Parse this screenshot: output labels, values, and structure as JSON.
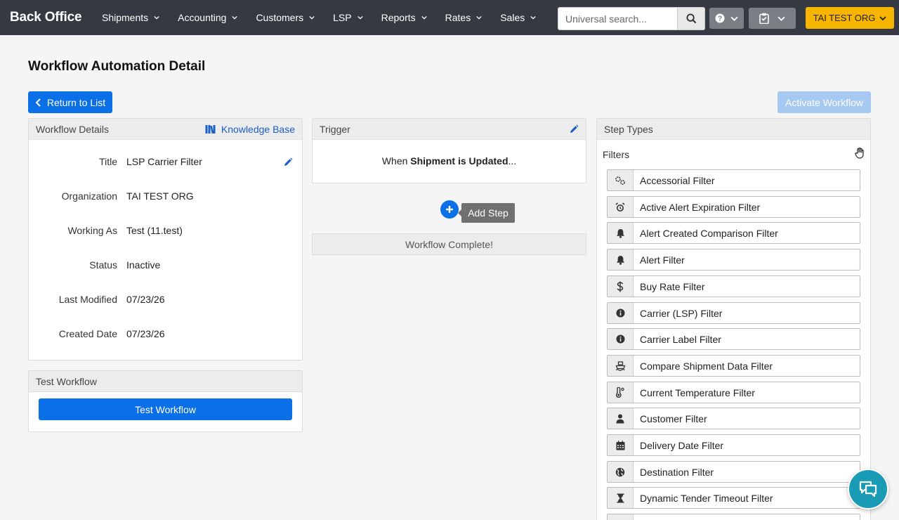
{
  "nav": {
    "brand": "Back Office",
    "items": [
      "Shipments",
      "Accounting",
      "Customers",
      "LSP",
      "Reports",
      "Rates",
      "Sales"
    ],
    "search_placeholder": "Universal search...",
    "org_label": "TAI TEST ORG"
  },
  "page": {
    "title": "Workflow Automation Detail",
    "return_label": "Return to List",
    "activate_label": "Activate Workflow"
  },
  "details": {
    "header": "Workflow Details",
    "kb_label": "Knowledge Base",
    "rows": [
      {
        "label": "Title",
        "value": "LSP Carrier Filter"
      },
      {
        "label": "Organization",
        "value": "TAI TEST ORG"
      },
      {
        "label": "Working As",
        "value": "Test (11.test)"
      },
      {
        "label": "Status",
        "value": "Inactive"
      },
      {
        "label": "Last Modified",
        "value": "07/23/26"
      },
      {
        "label": "Created Date",
        "value": "07/23/26"
      }
    ]
  },
  "test": {
    "header": "Test Workflow",
    "button_label": "Test Workflow"
  },
  "trigger": {
    "header": "Trigger",
    "prefix": "When ",
    "event": "Shipment is Updated",
    "suffix": "...",
    "add_step_label": "Add Step",
    "complete_label": "Workflow Complete!"
  },
  "steps": {
    "header": "Step Types",
    "section": "Filters",
    "items": [
      {
        "label": "Accessorial Filter",
        "icon": "gears-icon"
      },
      {
        "label": "Active Alert Expiration Filter",
        "icon": "alarm-clock-icon"
      },
      {
        "label": "Alert Created Comparison Filter",
        "icon": "bell-icon"
      },
      {
        "label": "Alert Filter",
        "icon": "bell-icon"
      },
      {
        "label": "Buy Rate Filter",
        "icon": "dollar-icon"
      },
      {
        "label": "Carrier (LSP) Filter",
        "icon": "info-icon"
      },
      {
        "label": "Carrier Label Filter",
        "icon": "info-icon"
      },
      {
        "label": "Compare Shipment Data Filter",
        "icon": "ship-icon"
      },
      {
        "label": "Current Temperature Filter",
        "icon": "thermometer-icon"
      },
      {
        "label": "Customer Filter",
        "icon": "person-icon"
      },
      {
        "label": "Delivery Date Filter",
        "icon": "calendar-icon"
      },
      {
        "label": "Destination Filter",
        "icon": "globe-icon"
      },
      {
        "label": "Dynamic Tender Timeout Filter",
        "icon": "hourglass-icon"
      }
    ]
  }
}
